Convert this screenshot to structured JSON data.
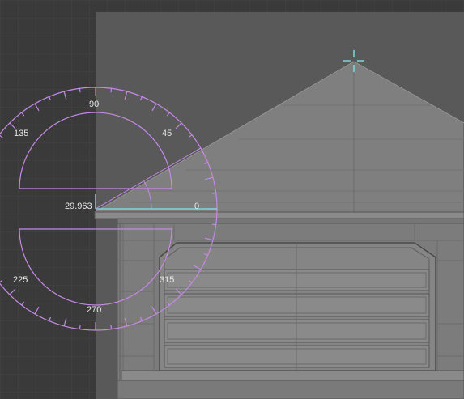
{
  "viewport": {
    "angle_readout": "29.963",
    "colors": {
      "background": "#3a3a3a",
      "grid": "#444444",
      "panel": "#595959",
      "model_face": "#7f7f7f",
      "model_edge": "#4a4a4a",
      "protractor": "#c58ae6",
      "snap_cursor": "#7fd6e0",
      "label": "#e8e8e8"
    }
  },
  "protractor": {
    "labels": [
      "90",
      "135",
      "45",
      "0",
      "225",
      "270",
      "315"
    ]
  },
  "snap_cursor": {
    "icon": "crosshair-icon"
  }
}
